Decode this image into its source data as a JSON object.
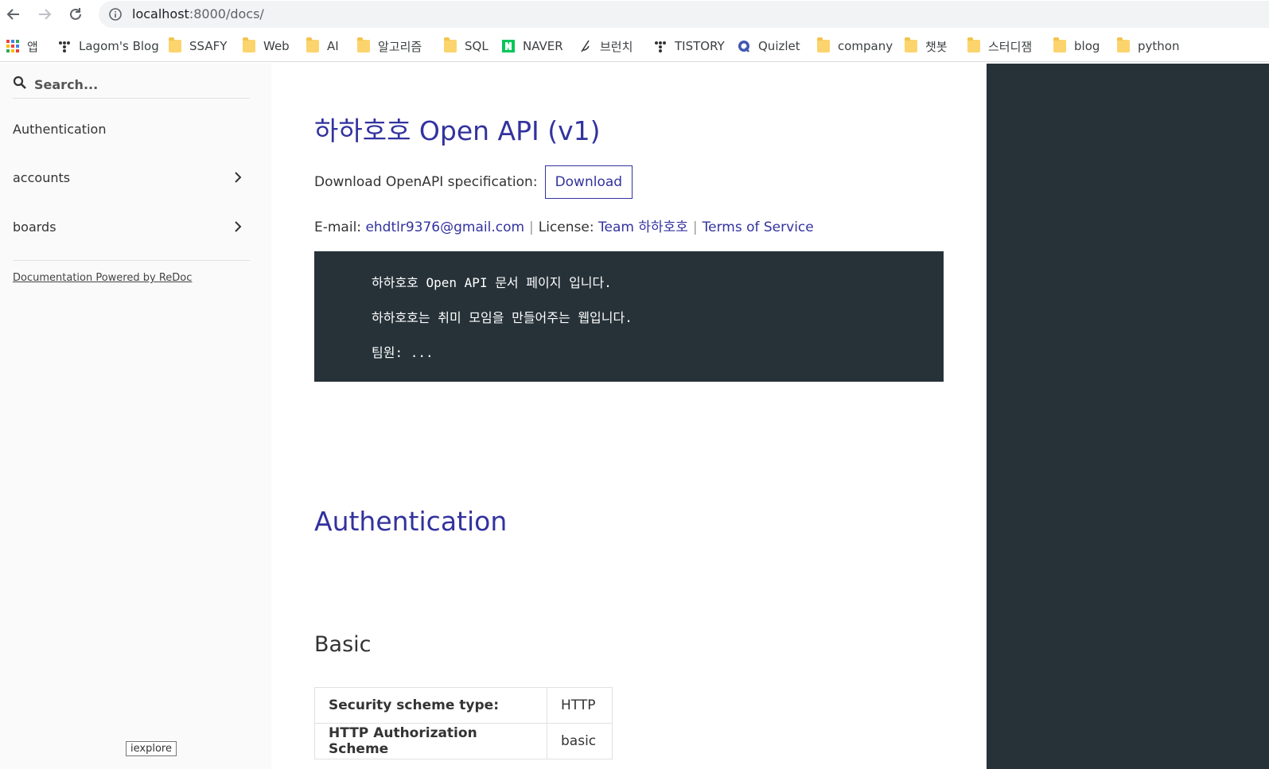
{
  "browser": {
    "url_host": "localhost",
    "url_rest": ":8000/docs/"
  },
  "bookmarks": [
    {
      "label": "앱",
      "icon": "apps-grid-icon"
    },
    {
      "label": "Lagom's Blog",
      "icon": "tistory-icon"
    },
    {
      "label": "SSAFY",
      "icon": "folder-icon"
    },
    {
      "label": "Web",
      "icon": "folder-icon"
    },
    {
      "label": "AI",
      "icon": "folder-icon"
    },
    {
      "label": "알고리즘",
      "icon": "folder-icon"
    },
    {
      "label": "SQL",
      "icon": "folder-icon"
    },
    {
      "label": "NAVER",
      "icon": "naver-icon"
    },
    {
      "label": "브런치",
      "icon": "brunch-icon"
    },
    {
      "label": "TISTORY",
      "icon": "tistory-icon"
    },
    {
      "label": "Quizlet",
      "icon": "quizlet-icon"
    },
    {
      "label": "company",
      "icon": "folder-icon"
    },
    {
      "label": "챗봇",
      "icon": "folder-icon"
    },
    {
      "label": "스터디잼",
      "icon": "folder-icon"
    },
    {
      "label": "blog",
      "icon": "folder-icon"
    },
    {
      "label": "python",
      "icon": "folder-icon"
    }
  ],
  "sidebar": {
    "search_placeholder": "Search...",
    "items": [
      {
        "label": "Authentication"
      },
      {
        "label": "accounts"
      },
      {
        "label": "boards"
      }
    ],
    "powered_by": "Documentation Powered by ReDoc"
  },
  "main": {
    "title": "하하호호 Open API (v1)",
    "download_label": "Download OpenAPI specification:",
    "download_button": "Download",
    "email_label": "E-mail:",
    "email": "ehdtlr9376@gmail.com",
    "license_label": "License:",
    "license": "Team 하하호호",
    "terms": "Terms of Service",
    "pipe": "|",
    "description": [
      "하하호호 Open API 문서 페이지 입니다.",
      "하하호호는 취미 모임을 만들어주는 웹입니다.",
      "팀원: ..."
    ],
    "auth_heading": "Authentication",
    "basic_heading": "Basic",
    "security_table": [
      {
        "key": "Security scheme type:",
        "value": "HTTP"
      },
      {
        "key": "HTTP Authorization Scheme",
        "value": "basic"
      }
    ]
  },
  "tooltip": "iexplore",
  "colors": {
    "accent": "#32329f",
    "dark_panel": "#263238",
    "sidebar_bg": "#fafafa"
  }
}
